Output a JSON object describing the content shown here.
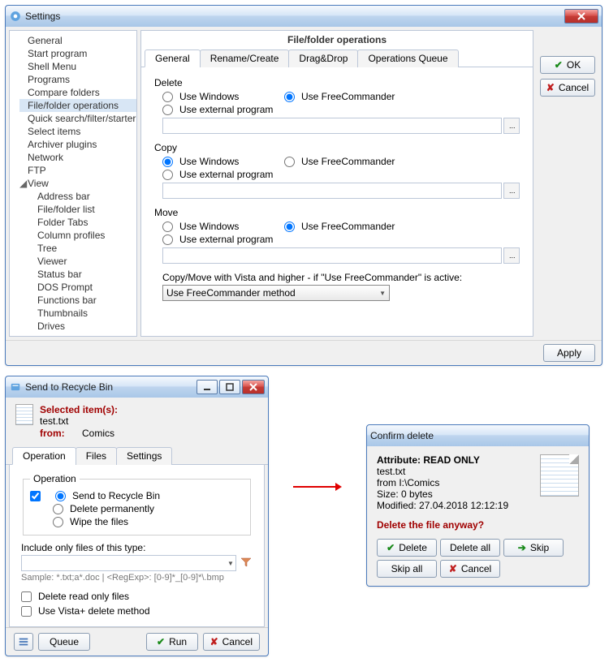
{
  "settings": {
    "title": "Settings",
    "tree": [
      {
        "label": "General"
      },
      {
        "label": "Start program"
      },
      {
        "label": "Shell Menu"
      },
      {
        "label": "Programs"
      },
      {
        "label": "Compare folders"
      },
      {
        "label": "File/folder operations",
        "selected": true
      },
      {
        "label": "Quick search/filter/starter"
      },
      {
        "label": "Select items"
      },
      {
        "label": "Archiver plugins"
      },
      {
        "label": "Network"
      },
      {
        "label": "FTP"
      }
    ],
    "view": {
      "label": "View",
      "children": [
        {
          "label": "Address bar"
        },
        {
          "label": "File/folder list"
        },
        {
          "label": "Folder Tabs"
        },
        {
          "label": "Column profiles"
        },
        {
          "label": "Tree"
        },
        {
          "label": "Viewer"
        },
        {
          "label": "Status bar"
        },
        {
          "label": "DOS Prompt"
        },
        {
          "label": "Functions bar"
        },
        {
          "label": "Thumbnails"
        },
        {
          "label": "Drives"
        }
      ]
    },
    "main": {
      "title": "File/folder operations",
      "tabs": [
        "General",
        "Rename/Create",
        "Drag&Drop",
        "Operations Queue"
      ],
      "sections": {
        "delete": {
          "label": "Delete",
          "useWindows": "Use Windows",
          "useFC": "Use FreeCommander",
          "useExt": "Use external program"
        },
        "copy": {
          "label": "Copy",
          "useWindows": "Use Windows",
          "useFC": "Use FreeCommander",
          "useExt": "Use external program"
        },
        "move": {
          "label": "Move",
          "useWindows": "Use Windows",
          "useFC": "Use FreeCommander",
          "useExt": "Use external program"
        }
      },
      "copyMoveLabel": "Copy/Move with Vista and higher - if \"Use FreeCommander\" is active:",
      "copyMoveValue": "Use FreeCommander method"
    },
    "buttons": {
      "ok": "OK",
      "cancel": "Cancel",
      "apply": "Apply"
    }
  },
  "recycle": {
    "title": "Send to Recycle Bin",
    "selectedLabel": "Selected item(s):",
    "file": "test.txt",
    "fromLabel": "from:",
    "fromValue": "Comics",
    "tabs": [
      "Operation",
      "Files",
      "Settings"
    ],
    "opLabel": "Operation",
    "opts": {
      "recycle": "Send to Recycle Bin",
      "perm": "Delete permanently",
      "wipe": "Wipe the files"
    },
    "includeLabel": "Include only files of this type:",
    "includeValue": "",
    "sample": "Sample: *.txt;a*.doc | <RegExp>: [0-9]*_[0-9]*\\.bmp",
    "delRO": "Delete read only files",
    "useVista": "Use Vista+ delete method",
    "queue": "Queue",
    "run": "Run",
    "cancel": "Cancel"
  },
  "confirm": {
    "title": "Confirm delete",
    "attr": "Attribute: READ ONLY",
    "file": "test.txt",
    "from": "from  I:\\Comics",
    "size": "Size:  0  bytes",
    "modified": "Modified:  27.04.2018 12:12:19",
    "question": "Delete the file anyway?",
    "delete": "Delete",
    "deleteAll": "Delete all",
    "skip": "Skip",
    "skipAll": "Skip all",
    "cancel": "Cancel"
  }
}
